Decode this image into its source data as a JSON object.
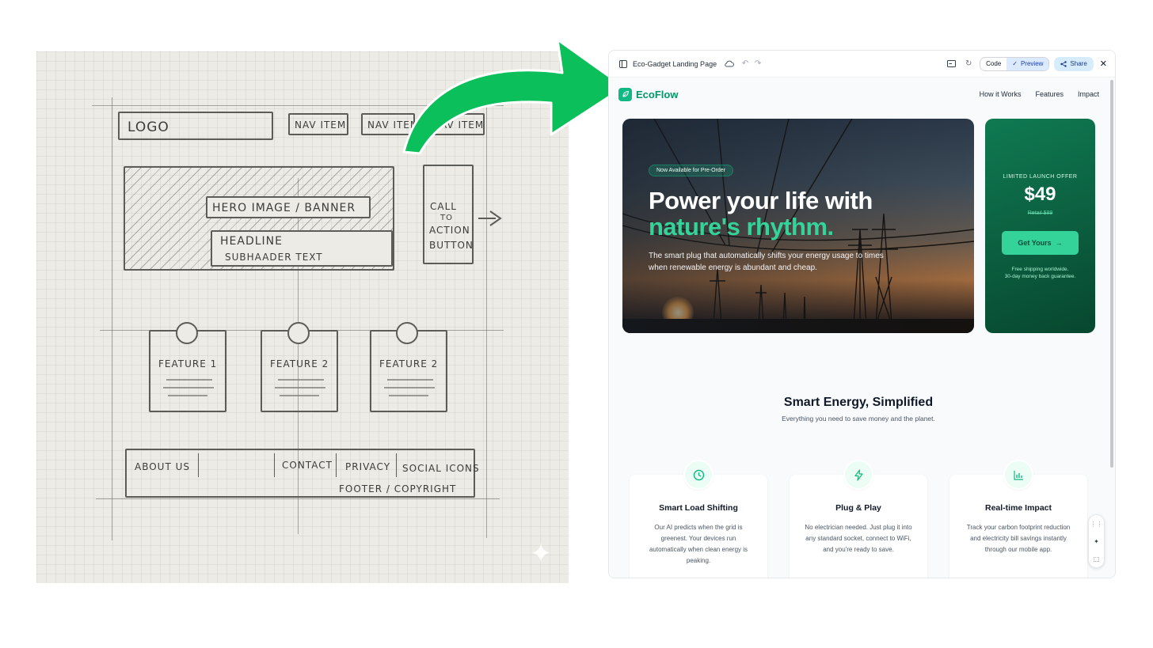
{
  "sketch": {
    "logo": "LOGO",
    "nav_items": [
      "NAV ITEM",
      "NAV ITEM",
      "NAV ITEM"
    ],
    "hero_banner": "HERO IMAGE / BANNER",
    "headline": "HEADLINE",
    "subheader": "SUBHAADER TEXT",
    "cta": [
      "CALL",
      "TO",
      "ACTION",
      "BUTTON"
    ],
    "features": [
      "FEATURE 1",
      "FEATURE 2",
      "FEATURE 2"
    ],
    "footer_links": [
      "ABOUT US",
      "CONTACT",
      "PRIVACY",
      "SOCIAL ICONS"
    ],
    "footer": "FOOTER / COPYRIGHT"
  },
  "arrow_color": "#0bbf5a",
  "window": {
    "title": "Eco-Gadget Landing Page",
    "code_label": "Code",
    "preview_label": "Preview",
    "share_label": "Share",
    "icons": [
      "layout-icon",
      "cloud-icon",
      "undo-icon",
      "redo-icon",
      "screen-icon",
      "refresh-icon",
      "check-icon",
      "share-icon",
      "close-icon"
    ]
  },
  "site": {
    "brand": "EcoFlow",
    "brand_color": "#10b981",
    "nav": [
      "How it Works",
      "Features",
      "Impact"
    ],
    "hero": {
      "badge": "Now Available for Pre-Order",
      "headline_line1": "Power your life with",
      "headline_line2": "nature's rhythm.",
      "subtext": "The smart plug that automatically shifts your energy usage to times when renewable energy is abundant and cheap."
    },
    "offer": {
      "label": "LIMITED LAUNCH OFFER",
      "price": "$49",
      "retail": "Retail $89",
      "button": "Get Yours",
      "note_line1": "Free shipping worldwide.",
      "note_line2": "30-day money back guarantee."
    },
    "section": {
      "title": "Smart Energy, Simplified",
      "subtitle": "Everything you need to save money and the planet."
    },
    "features": [
      {
        "icon": "clock-icon",
        "title": "Smart Load Shifting",
        "body": "Our AI predicts when the grid is greenest. Your devices run automatically when clean energy is peaking."
      },
      {
        "icon": "lightning-icon",
        "title": "Plug & Play",
        "body": "No electrician needed. Just plug it into any standard socket, connect to WiFi, and you're ready to save."
      },
      {
        "icon": "bar-chart-icon",
        "title": "Real-time Impact",
        "body": "Track your carbon footprint reduction and electricity bill savings instantly through our mobile app."
      }
    ]
  }
}
